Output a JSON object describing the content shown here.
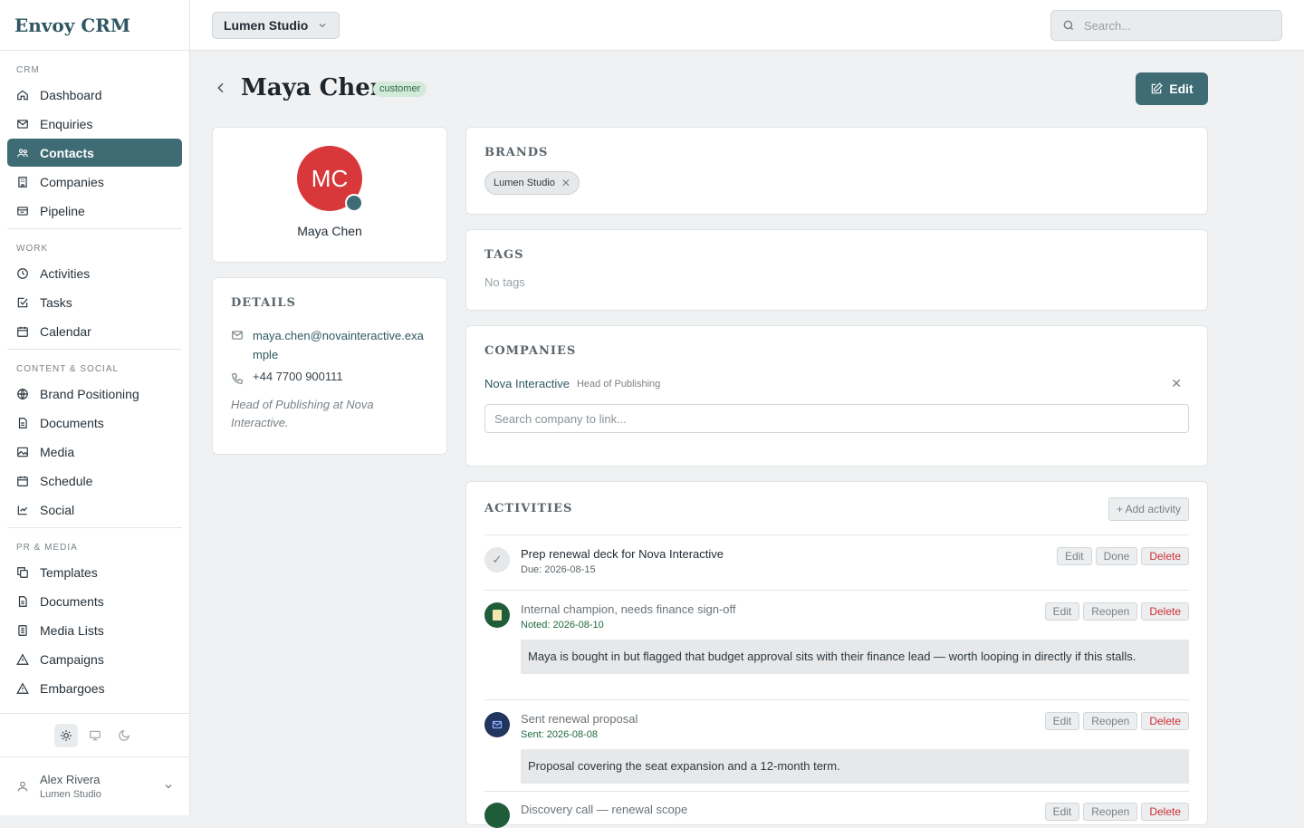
{
  "app": {
    "name": "Envoy CRM"
  },
  "sidebar": {
    "sections": [
      {
        "label": "CRM",
        "items": [
          {
            "label": "Dashboard",
            "icon": "home-icon"
          },
          {
            "label": "Enquiries",
            "icon": "mail-icon"
          },
          {
            "label": "Contacts",
            "icon": "users-icon",
            "active": true
          },
          {
            "label": "Companies",
            "icon": "building-icon"
          },
          {
            "label": "Pipeline",
            "icon": "pipeline-icon"
          }
        ]
      },
      {
        "label": "WORK",
        "items": [
          {
            "label": "Activities",
            "icon": "clock-icon"
          },
          {
            "label": "Tasks",
            "icon": "check-square-icon"
          },
          {
            "label": "Calendar",
            "icon": "calendar-icon"
          }
        ]
      },
      {
        "label": "CONTENT & SOCIAL",
        "items": [
          {
            "label": "Brand Positioning",
            "icon": "globe-icon"
          },
          {
            "label": "Documents",
            "icon": "document-icon"
          },
          {
            "label": "Media",
            "icon": "image-icon"
          },
          {
            "label": "Schedule",
            "icon": "calendar-icon"
          },
          {
            "label": "Social",
            "icon": "chart-icon"
          }
        ]
      },
      {
        "label": "PR & MEDIA",
        "items": [
          {
            "label": "Templates",
            "icon": "copy-icon"
          },
          {
            "label": "Documents",
            "icon": "document-icon"
          },
          {
            "label": "Media Lists",
            "icon": "list-icon"
          },
          {
            "label": "Campaigns",
            "icon": "triangle-icon"
          },
          {
            "label": "Embargoes",
            "icon": "alert-icon"
          }
        ]
      }
    ],
    "theme": {
      "options": [
        "light",
        "system",
        "dark"
      ],
      "selected": "light"
    },
    "user": {
      "name": "Alex Rivera",
      "org": "Lumen Studio"
    }
  },
  "topbar": {
    "brand": "Lumen Studio",
    "search_placeholder": "Search..."
  },
  "contact": {
    "name": "Maya Chen",
    "status": "customer",
    "initials": "MC",
    "edit_label": "Edit",
    "details": {
      "title": "DETAILS",
      "email": "maya.chen@novainteractive.example",
      "phone": "+44 7700 900111",
      "note": "Head of Publishing at Nova Interactive."
    }
  },
  "brands": {
    "title": "BRANDS",
    "items": [
      "Lumen Studio"
    ]
  },
  "tags": {
    "title": "TAGS",
    "empty": "No tags"
  },
  "companies": {
    "title": "COMPANIES",
    "items": [
      {
        "name": "Nova Interactive",
        "role": "Head of Publishing"
      }
    ],
    "search_placeholder": "Search company to link..."
  },
  "activities": {
    "title": "ACTIVITIES",
    "add_label": "+ Add activity",
    "items": [
      {
        "title": "Prep renewal deck for Nova Interactive",
        "meta": "Due: 2026-08-15",
        "actions": [
          "Edit",
          "Done",
          "Delete"
        ],
        "icon": "check-icon"
      },
      {
        "title": "Internal champion, needs finance sign-off",
        "meta": "Noted: 2026-08-10",
        "note": "Maya is bought in but flagged that budget approval sits with their finance lead — worth looping in directly if this stalls.",
        "actions": [
          "Edit",
          "Reopen",
          "Delete"
        ],
        "icon": "note-icon"
      },
      {
        "title": "Sent renewal proposal",
        "meta": "Sent: 2026-08-08",
        "note": "Proposal covering the seat expansion and a 12-month term.",
        "actions": [
          "Edit",
          "Reopen",
          "Delete"
        ],
        "icon": "mail-icon"
      },
      {
        "title": "Discovery call — renewal scope",
        "meta": "",
        "actions": [
          "Edit",
          "Reopen",
          "Delete"
        ],
        "icon": "phone-icon"
      }
    ]
  },
  "colors": {
    "accent": "#3f6b75",
    "danger": "#cc2f35",
    "avatar": "#d9383a",
    "badge_bg": "#d3eadb"
  }
}
